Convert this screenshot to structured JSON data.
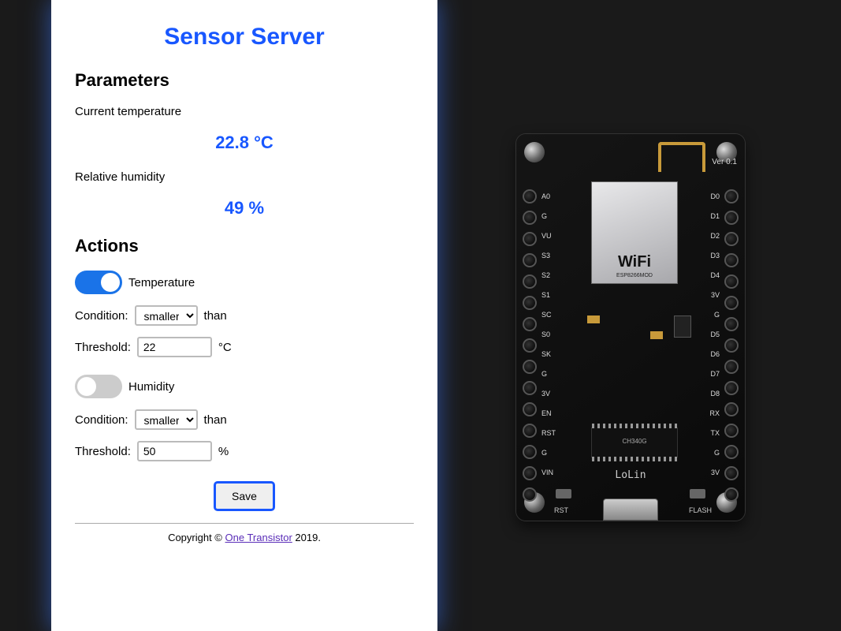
{
  "title": "Sensor Server",
  "sections": {
    "parameters": "Parameters",
    "actions": "Actions"
  },
  "params": {
    "temp_label": "Current temperature",
    "temp_value": "22.8 °C",
    "hum_label": "Relative humidity",
    "hum_value": "49 %"
  },
  "temp_action": {
    "toggle_label": "Temperature",
    "toggle_on": true,
    "condition_label": "Condition:",
    "condition_value": "smaller",
    "condition_suffix": "than",
    "threshold_label": "Threshold:",
    "threshold_value": "22",
    "threshold_unit": "°C"
  },
  "hum_action": {
    "toggle_label": "Humidity",
    "toggle_on": false,
    "condition_label": "Condition:",
    "condition_value": "smaller",
    "condition_suffix": "than",
    "threshold_label": "Threshold:",
    "threshold_value": "50",
    "threshold_unit": "%"
  },
  "save_label": "Save",
  "footer": {
    "prefix": "Copyright © ",
    "link": "One Transistor",
    "suffix": " 2019."
  },
  "board": {
    "version": "Ver 0.1",
    "brand": "LoLin",
    "ic": "CH340G",
    "rst": "RST",
    "flash": "FLASH",
    "left_pins": [
      "A0",
      "G",
      "VU",
      "S3",
      "S2",
      "S1",
      "SC",
      "S0",
      "SK",
      "G",
      "3V",
      "EN",
      "RST",
      "G",
      "VIN"
    ],
    "right_pins": [
      "D0",
      "D1",
      "D2",
      "D3",
      "D4",
      "3V",
      "G",
      "D5",
      "D6",
      "D7",
      "D8",
      "RX",
      "TX",
      "G",
      "3V"
    ]
  }
}
